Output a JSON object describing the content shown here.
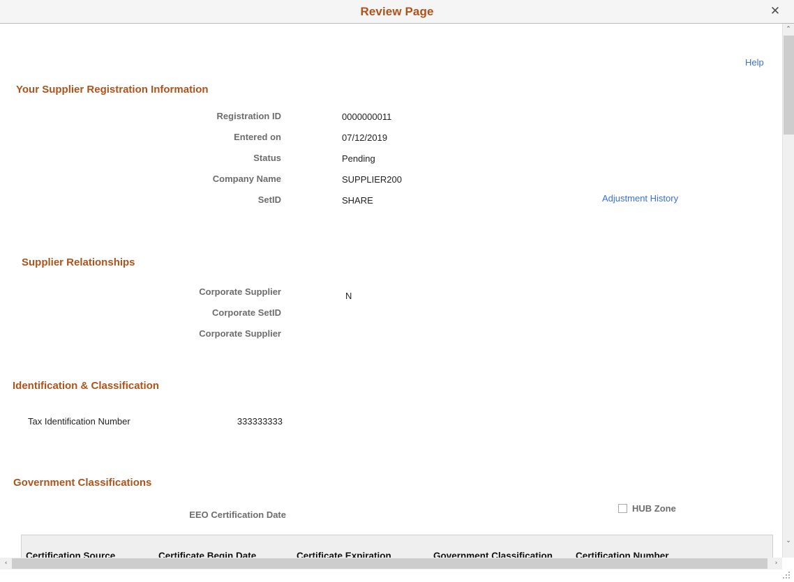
{
  "window": {
    "title": "Review Page",
    "close_icon": "close-icon",
    "close_glyph": "✕"
  },
  "help": {
    "label": "Help"
  },
  "sections": {
    "registration": {
      "heading": "Your Supplier Registration Information",
      "fields": [
        {
          "label": "Registration ID",
          "value": "0000000011"
        },
        {
          "label": "Entered on",
          "value": "07/12/2019"
        },
        {
          "label": "Status",
          "value": "Pending"
        },
        {
          "label": "Company Name",
          "value": "SUPPLIER200"
        },
        {
          "label": "SetID",
          "value": "SHARE"
        }
      ],
      "adjustment_history_link": "Adjustment History"
    },
    "relationships": {
      "heading": "Supplier Relationships",
      "fields": [
        {
          "label": "Corporate Supplier",
          "value": "N"
        },
        {
          "label": "Corporate SetID",
          "value": ""
        },
        {
          "label": "Corporate Supplier",
          "value": ""
        }
      ]
    },
    "identification": {
      "heading": "Identification & Classification",
      "tax_label": "Tax Identification Number",
      "tax_value": "333333333"
    },
    "government": {
      "heading": "Government Classifications",
      "eeo_label": "EEO Certification Date",
      "hub_zone_label": "HUB Zone",
      "hub_zone_checked": false,
      "grid": {
        "columns": [
          "Certification Source",
          "Certificate Begin Date",
          "Certificate Expiration",
          "Government Classification",
          "Certification Number"
        ],
        "rows": []
      }
    }
  },
  "scrollbars": {
    "vertical": {
      "up_glyph": "⌃",
      "down_glyph": "⌄"
    },
    "horizontal": {
      "left_glyph": "‹",
      "right_glyph": "›"
    }
  },
  "colors": {
    "heading": "#b0521a",
    "link": "#3a6fd8",
    "label": "#6d6d6d",
    "value": "#222222",
    "grid_header_bg": "#efefef"
  }
}
